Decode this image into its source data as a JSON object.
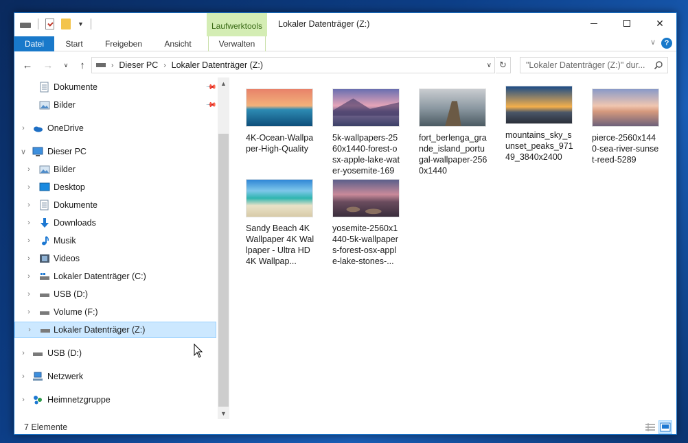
{
  "window": {
    "title": "Lokaler Datenträger (Z:)",
    "context_tab": "Laufwerktools"
  },
  "ribbon": {
    "tabs": [
      "Datei",
      "Start",
      "Freigeben",
      "Ansicht",
      "Verwalten"
    ],
    "help": "?"
  },
  "address": {
    "crumbs": [
      "Dieser PC",
      "Lokaler Datenträger (Z:)"
    ],
    "search_placeholder": "\"Lokaler Datenträger (Z:)\" dur..."
  },
  "nav": {
    "quick_access": [
      {
        "label": "Dokumente",
        "icon": "documents-icon",
        "pinned": true
      },
      {
        "label": "Bilder",
        "icon": "pictures-icon",
        "pinned": true
      }
    ],
    "onedrive": "OneDrive",
    "this_pc": "Dieser PC",
    "this_pc_items": [
      {
        "label": "Bilder",
        "icon": "pictures-icon"
      },
      {
        "label": "Desktop",
        "icon": "desktop-icon"
      },
      {
        "label": "Dokumente",
        "icon": "documents-icon"
      },
      {
        "label": "Downloads",
        "icon": "downloads-icon"
      },
      {
        "label": "Musik",
        "icon": "music-icon"
      },
      {
        "label": "Videos",
        "icon": "videos-icon"
      },
      {
        "label": "Lokaler Datenträger (C:)",
        "icon": "system-drive-icon"
      },
      {
        "label": "USB (D:)",
        "icon": "drive-icon"
      },
      {
        "label": "Volume (F:)",
        "icon": "drive-icon"
      },
      {
        "label": "Lokaler Datenträger (Z:)",
        "icon": "drive-icon",
        "selected": true
      }
    ],
    "usb": "USB (D:)",
    "network": "Netzwerk",
    "homegroup": "Heimnetzgruppe"
  },
  "files": [
    {
      "name": "4K-Ocean-Wallpaper-High-Quality"
    },
    {
      "name": "5k-wallpapers-2560x1440-forest-osx-apple-lake-water-yosemite-169"
    },
    {
      "name": "fort_berlenga_grande_island_portugal-wallpaper-2560x1440"
    },
    {
      "name": "mountains_sky_sunset_peaks_97149_3840x2400"
    },
    {
      "name": "pierce-2560x1440-sea-river-sunset-reed-5289"
    },
    {
      "name": "Sandy Beach 4K Wallpaper  4K Wallpaper - Ultra HD 4K Wallpap..."
    },
    {
      "name": "yosemite-2560x1440-5k-wallpapers-forest-osx-apple-lake-stones-..."
    }
  ],
  "status": {
    "count": "7 Elemente"
  }
}
